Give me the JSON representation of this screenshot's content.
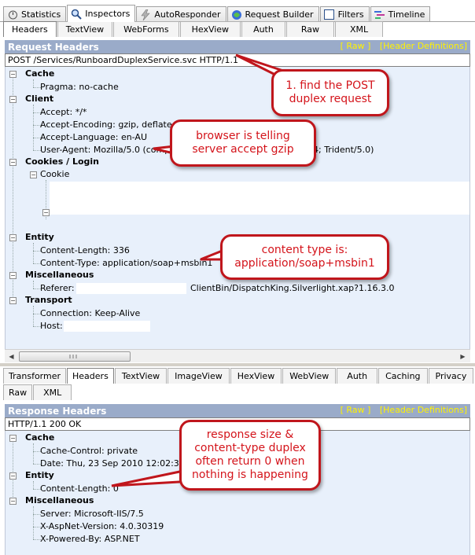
{
  "top_tabs": [
    {
      "label": "Statistics",
      "icon": "stopwatch-icon"
    },
    {
      "label": "Inspectors",
      "icon": "magnifier-icon",
      "active": true
    },
    {
      "label": "AutoResponder",
      "icon": "lightning-icon"
    },
    {
      "label": "Request Builder",
      "icon": "composer-icon"
    },
    {
      "label": "Filters",
      "icon": "checkbox-icon"
    },
    {
      "label": "Timeline",
      "icon": "timeline-icon"
    }
  ],
  "request": {
    "tabs": [
      "Headers",
      "TextView",
      "WebForms",
      "HexView",
      "Auth",
      "Raw",
      "XML"
    ],
    "title": "Request Headers",
    "raw_link": "[ Raw ]",
    "defs_link": "[Header Definitions]",
    "line": "POST /Services/RunboardDuplexService.svc HTTP/1.1",
    "groups": {
      "cache": {
        "label": "Cache",
        "items": [
          "Pragma: no-cache"
        ]
      },
      "client": {
        "label": "Client",
        "items": [
          "Accept: */*",
          "Accept-Encoding: gzip, deflate",
          "Accept-Language: en-AU",
          "User-Agent: Mozilla/5.0 (compat",
          "4; Trident/5.0)"
        ]
      },
      "cookies": {
        "label": "Cookies / Login",
        "cookie_label": "Cookie"
      },
      "entity": {
        "label": "Entity",
        "items": [
          "Content-Length: 336",
          "Content-Type: application/soap+msbin1"
        ]
      },
      "misc": {
        "label": "Miscellaneous",
        "referer_label": "Referer:",
        "referer_tail": "ClientBin/DispatchKing.Silverlight.xap?1.16.3.0"
      },
      "transport": {
        "label": "Transport",
        "items": [
          "Connection: Keep-Alive",
          "Host:"
        ]
      }
    }
  },
  "response": {
    "tabs": [
      "Transformer",
      "Headers",
      "TextView",
      "ImageView",
      "HexView",
      "WebView",
      "Auth",
      "Caching",
      "Privacy"
    ],
    "tabs2": [
      "Raw",
      "XML"
    ],
    "title": "Response Headers",
    "raw_link": "[ Raw ]",
    "defs_link": "[Header Definitions]",
    "line": "HTTP/1.1 200 OK",
    "groups": {
      "cache": {
        "label": "Cache",
        "items": [
          "Cache-Control: private",
          "Date: Thu, 23 Sep 2010 12:02:31 G"
        ]
      },
      "entity": {
        "label": "Entity",
        "items": [
          "Content-Length: 0"
        ]
      },
      "misc": {
        "label": "Miscellaneous",
        "items": [
          "Server: Microsoft-IIS/7.5",
          "X-AspNet-Version: 4.0.30319",
          "X-Powered-By: ASP.NET"
        ]
      }
    }
  },
  "callouts": {
    "post": "1. find the POST duplex request",
    "gzip": "browser is telling server accept gzip",
    "content_type": "content type is: application/soap+msbin1",
    "response": "response size & content-type duplex often return 0 when nothing is happening"
  },
  "colors": {
    "accent_red": "#c0161c",
    "header_bar": "#9aabc9",
    "link_yellow": "#fff200",
    "tree_bg": "#e8f0fb"
  }
}
